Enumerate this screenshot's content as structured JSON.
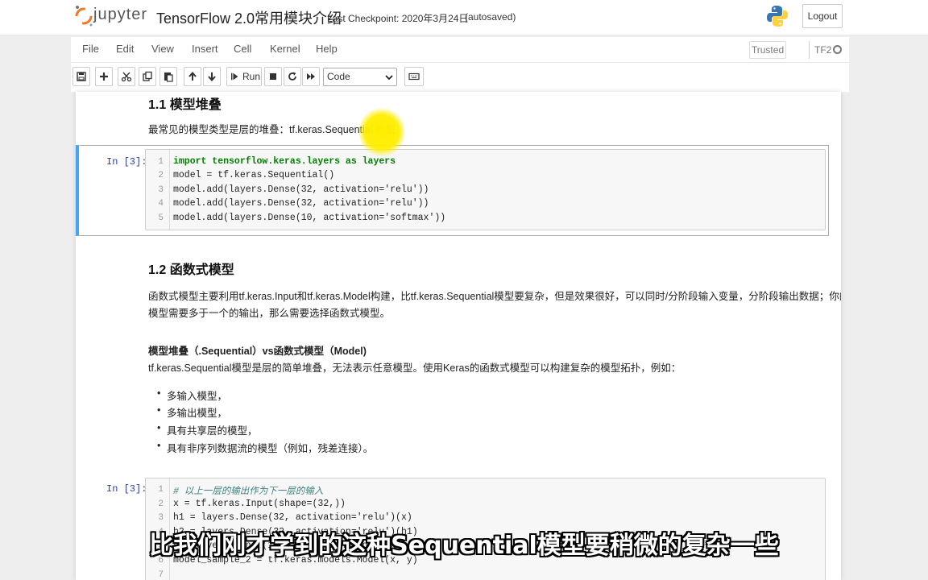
{
  "header": {
    "logo_text": "jupyter",
    "notebook_title": "TensorFlow 2.0常用模块介绍",
    "checkpoint": "Last Checkpoint: 2020年3月24日",
    "autosave_status": "(autosaved)",
    "logout_label": "Logout"
  },
  "menubar": {
    "items": [
      "File",
      "Edit",
      "View",
      "Insert",
      "Cell",
      "Kernel",
      "Help"
    ],
    "trusted_label": "Trusted",
    "kernel_name": "TF2"
  },
  "toolbar": {
    "run_label": "Run",
    "cell_type_value": "Code"
  },
  "section1": {
    "heading": "1.1 模型堆叠",
    "text": "最常见的模型类型是层的堆叠：tf.keras.Sequential 模型"
  },
  "cell1": {
    "prompt": "In [3]:",
    "line_numbers": [
      "1",
      "2",
      "3",
      "4",
      "5"
    ],
    "lines": [
      "import tensorflow.keras.layers as layers",
      "model = tf.keras.Sequential()",
      "model.add(layers.Dense(32, activation='relu'))",
      "model.add(layers.Dense(32, activation='relu'))",
      "model.add(layers.Dense(10, activation='softmax'))"
    ]
  },
  "section2": {
    "heading": "1.2 函数式模型",
    "para_line1": "函数式模型主要利用tf.keras.Input和tf.keras.Model构建，比tf.keras.Sequential模型要复杂，但是效果很好，可以同时/分阶段输入变量，分阶段输出数据；你的",
    "para_line2": "模型需要多于一个的输出，那么需要选择函数式模型。",
    "compare_title": "模型堆叠（.Sequential）vs函数式模型（Model)",
    "compare_text": "tf.keras.Sequential模型是层的简单堆叠，无法表示任意模型。使用Keras的函数式模型可以构建复杂的模型拓扑，例如：",
    "bullets": [
      "多输入模型，",
      "多输出模型，",
      "具有共享层的模型，",
      "具有非序列数据流的模型（例如，残差连接）。"
    ]
  },
  "cell2": {
    "prompt": "In [3]:",
    "line_numbers": [
      "1",
      "2",
      "3",
      "4",
      "5",
      "6",
      "7"
    ],
    "lines": [
      "# 以上一层的输出作为下一层的输入",
      "x = tf.keras.Input(shape=(32,))",
      "h1 = layers.Dense(32, activation='relu')(x)",
      "h2 = layers.Dense(32, activation='relu')(h1)",
      "y = layers.Dense(10, activation='softmax')(h2)",
      "model_sample_2 = tf.keras.models.Model(x, y)",
      ""
    ]
  },
  "subtitle": "比我们刚才学到的这种Sequential模型要稍微的复杂一些",
  "colors": {
    "accent_selected": "#42a5f5",
    "prompt_blue": "#303f9f",
    "keyword_green": "#008000",
    "string_red": "#ba2121"
  }
}
